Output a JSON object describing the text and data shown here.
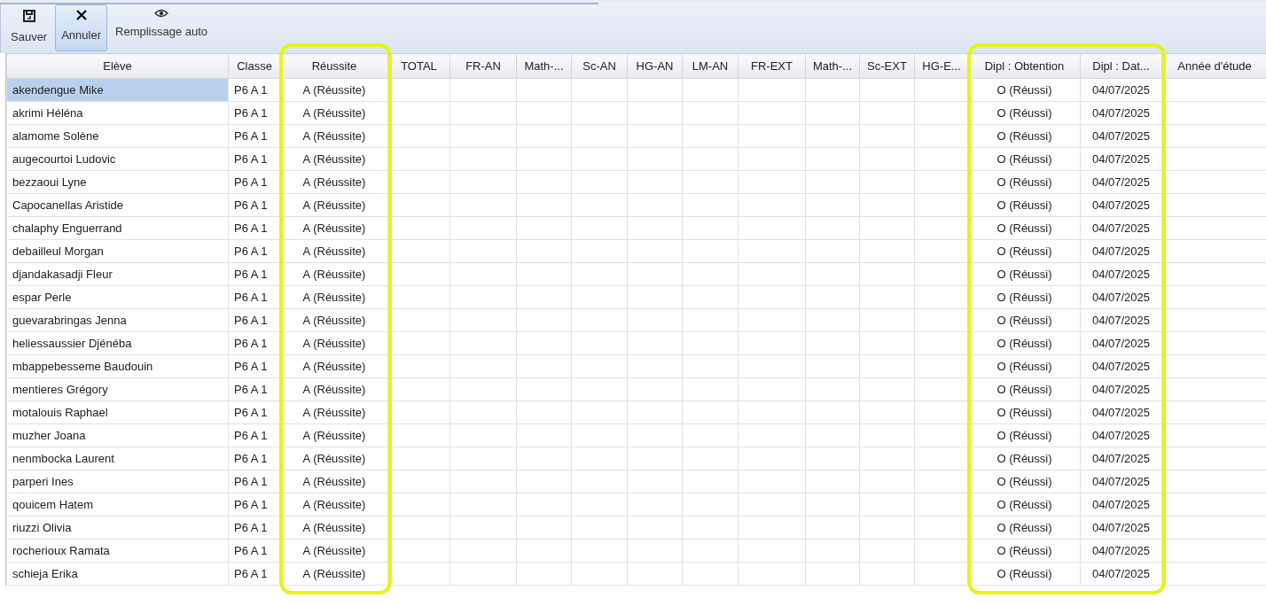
{
  "toolbar": [
    {
      "label": "Sauver",
      "pressed": false
    },
    {
      "label": "Annuler",
      "pressed": true
    },
    {
      "label": "Remplissage auto",
      "pressed": false
    }
  ],
  "table": {
    "columns": [
      {
        "label": "Elève",
        "kind": "student",
        "highlighted": false
      },
      {
        "label": "Classe",
        "kind": "class",
        "highlighted": false
      },
      {
        "label": "Réussite",
        "kind": "result",
        "highlighted": true
      },
      {
        "label": "TOTAL",
        "kind": "grade",
        "highlighted": false
      },
      {
        "label": "FR-AN",
        "kind": "grade",
        "highlighted": false
      },
      {
        "label": "Math-...",
        "kind": "grade",
        "highlighted": false
      },
      {
        "label": "Sc-AN",
        "kind": "grade",
        "highlighted": false
      },
      {
        "label": "HG-AN",
        "kind": "grade",
        "highlighted": false
      },
      {
        "label": "LM-AN",
        "kind": "grade",
        "highlighted": false
      },
      {
        "label": "FR-EXT",
        "kind": "grade",
        "highlighted": false
      },
      {
        "label": "Math-...",
        "kind": "grade",
        "highlighted": false
      },
      {
        "label": "Sc-EXT",
        "kind": "grade",
        "highlighted": false
      },
      {
        "label": "HG-E...",
        "kind": "grade",
        "highlighted": false
      },
      {
        "label": "Dipl : Obtention",
        "kind": "diploma",
        "highlighted": true
      },
      {
        "label": "Dipl : Dat...",
        "kind": "date",
        "highlighted": true
      },
      {
        "label": "Année d'étude",
        "kind": "year",
        "highlighted": false
      }
    ],
    "rows": [
      {
        "student": "akendengue Mike",
        "class": "P6 A 1",
        "result": "A (Réussite)",
        "diploma": "O (Réussi)",
        "date": "04/07/2025",
        "selected": true
      },
      {
        "student": "akrimi Héléna",
        "class": "P6 A 1",
        "result": "A (Réussite)",
        "diploma": "O (Réussi)",
        "date": "04/07/2025",
        "selected": false
      },
      {
        "student": "alamome Solène",
        "class": "P6 A 1",
        "result": "A (Réussite)",
        "diploma": "O (Réussi)",
        "date": "04/07/2025",
        "selected": false
      },
      {
        "student": "augecourtoi Ludovic",
        "class": "P6 A 1",
        "result": "A (Réussite)",
        "diploma": "O (Réussi)",
        "date": "04/07/2025",
        "selected": false
      },
      {
        "student": "bezzaoui Lyne",
        "class": "P6 A 1",
        "result": "A (Réussite)",
        "diploma": "O (Réussi)",
        "date": "04/07/2025",
        "selected": false
      },
      {
        "student": "Capocanellas Aristide",
        "class": "P6 A 1",
        "result": "A (Réussite)",
        "diploma": "O (Réussi)",
        "date": "04/07/2025",
        "selected": false
      },
      {
        "student": "chalaphy Enguerrand",
        "class": "P6 A 1",
        "result": "A (Réussite)",
        "diploma": "O (Réussi)",
        "date": "04/07/2025",
        "selected": false
      },
      {
        "student": "debailleul Morgan",
        "class": "P6 A 1",
        "result": "A (Réussite)",
        "diploma": "O (Réussi)",
        "date": "04/07/2025",
        "selected": false
      },
      {
        "student": "djandakasadji Fleur",
        "class": "P6 A 1",
        "result": "A (Réussite)",
        "diploma": "O (Réussi)",
        "date": "04/07/2025",
        "selected": false
      },
      {
        "student": "espar Perle",
        "class": "P6 A 1",
        "result": "A (Réussite)",
        "diploma": "O (Réussi)",
        "date": "04/07/2025",
        "selected": false
      },
      {
        "student": "guevarabringas Jenna",
        "class": "P6 A 1",
        "result": "A (Réussite)",
        "diploma": "O (Réussi)",
        "date": "04/07/2025",
        "selected": false
      },
      {
        "student": "heliessaussier Djénéba",
        "class": "P6 A 1",
        "result": "A (Réussite)",
        "diploma": "O (Réussi)",
        "date": "04/07/2025",
        "selected": false
      },
      {
        "student": "mbappebesseme Baudouin",
        "class": "P6 A 1",
        "result": "A (Réussite)",
        "diploma": "O (Réussi)",
        "date": "04/07/2025",
        "selected": false
      },
      {
        "student": "mentieres Grégory",
        "class": "P6 A 1",
        "result": "A (Réussite)",
        "diploma": "O (Réussi)",
        "date": "04/07/2025",
        "selected": false
      },
      {
        "student": "motalouis Raphael",
        "class": "P6 A 1",
        "result": "A (Réussite)",
        "diploma": "O (Réussi)",
        "date": "04/07/2025",
        "selected": false
      },
      {
        "student": "muzher Joana",
        "class": "P6 A 1",
        "result": "A (Réussite)",
        "diploma": "O (Réussi)",
        "date": "04/07/2025",
        "selected": false
      },
      {
        "student": "nenmbocka Laurent",
        "class": "P6 A 1",
        "result": "A (Réussite)",
        "diploma": "O (Réussi)",
        "date": "04/07/2025",
        "selected": false
      },
      {
        "student": "parperi Ines",
        "class": "P6 A 1",
        "result": "A (Réussite)",
        "diploma": "O (Réussi)",
        "date": "04/07/2025",
        "selected": false
      },
      {
        "student": "qouicem Hatem",
        "class": "P6 A 1",
        "result": "A (Réussite)",
        "diploma": "O (Réussi)",
        "date": "04/07/2025",
        "selected": false
      },
      {
        "student": "riuzzi Olivia",
        "class": "P6 A 1",
        "result": "A (Réussite)",
        "diploma": "O (Réussi)",
        "date": "04/07/2025",
        "selected": false
      },
      {
        "student": "rocherioux Ramata",
        "class": "P6 A 1",
        "result": "A (Réussite)",
        "diploma": "O (Réussi)",
        "date": "04/07/2025",
        "selected": false
      },
      {
        "student": "schieja Erika",
        "class": "P6 A 1",
        "result": "A (Réussite)",
        "diploma": "O (Réussi)",
        "date": "04/07/2025",
        "selected": false
      }
    ]
  }
}
